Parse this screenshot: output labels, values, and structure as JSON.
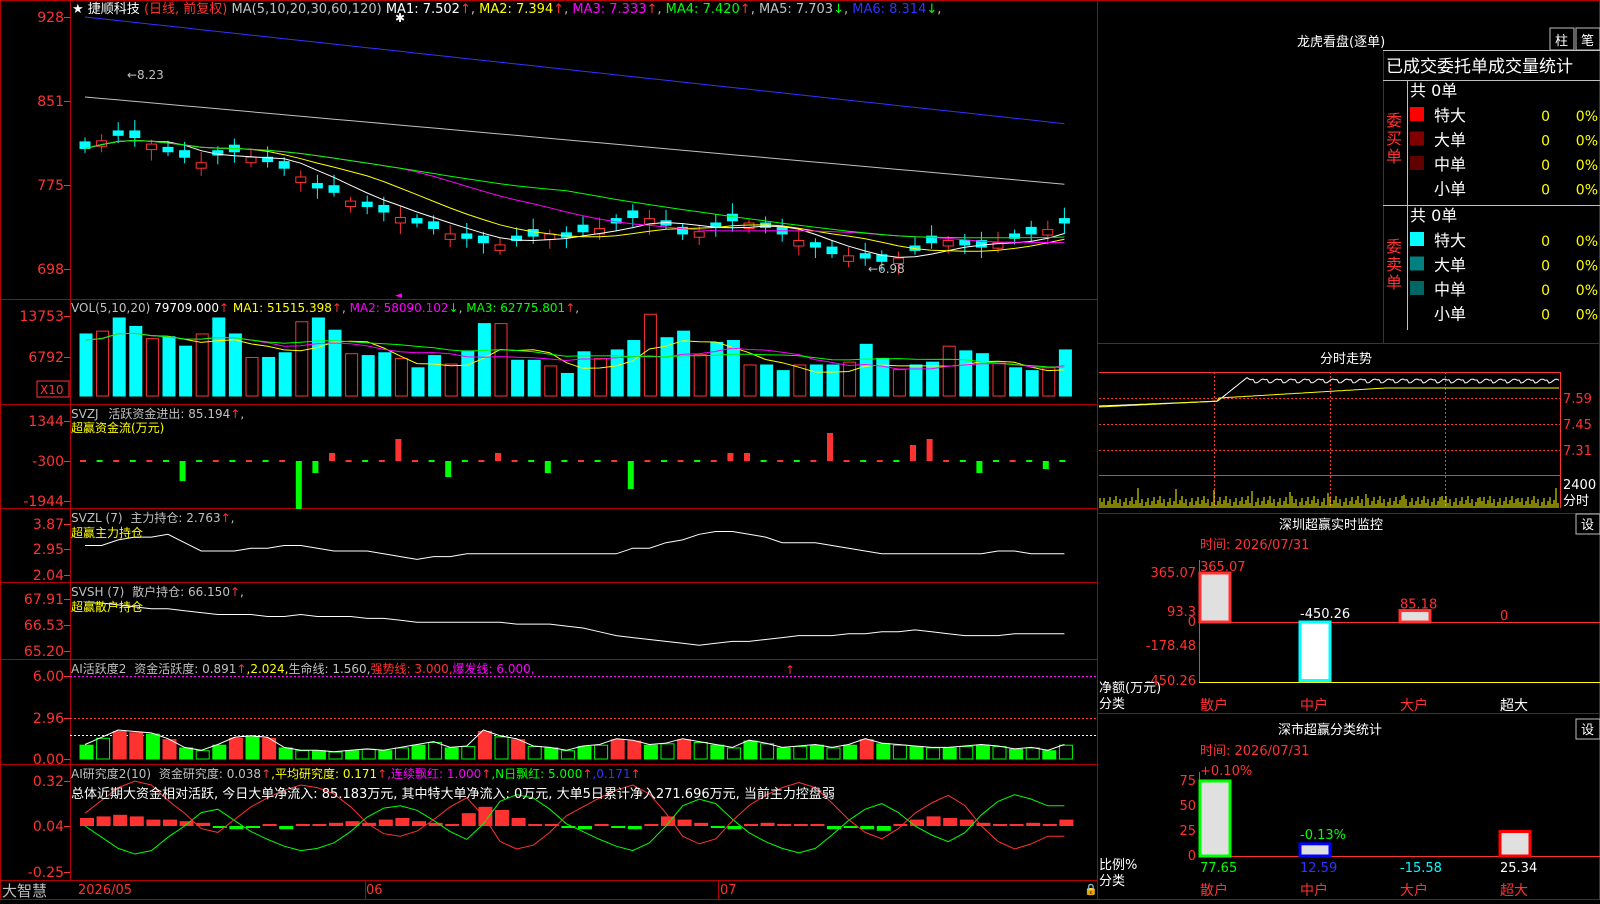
{
  "colors": {
    "up": "#ff3232",
    "down": "#00ffff",
    "grid": "#b40000",
    "yellow": "#ffff00",
    "magenta": "#ff00ff",
    "green": "#00ff00",
    "blue": "#3232ff",
    "white": "#ffffff",
    "gray": "#c0c0c0"
  },
  "header": {
    "star": "★",
    "stock": "捷顺科技",
    "period": "(日线, 前复权)",
    "ma_params": "MA(5,10,20,30,60,120)",
    "ma_items": [
      {
        "label": "MA1:",
        "value": "7.502",
        "arrow": "↑",
        "color": "#ffffff"
      },
      {
        "label": "MA2:",
        "value": "7.394",
        "arrow": "↑",
        "color": "#ffff00"
      },
      {
        "label": "MA3:",
        "value": "7.333",
        "arrow": "↑",
        "color": "#ff00ff"
      },
      {
        "label": "MA4:",
        "value": "7.420",
        "arrow": "↑",
        "color": "#00ff00"
      },
      {
        "label": "MA5:",
        "value": "7.703",
        "arrow": "↓",
        "color": "#c0c0c0"
      },
      {
        "label": "MA6:",
        "value": "8.314",
        "arrow": "↓",
        "color": "#3232ff"
      }
    ]
  },
  "price_axis": [
    "928",
    "851",
    "775",
    "698"
  ],
  "price_annotations": {
    "high": "←8.23",
    "low": "←6.98"
  },
  "vol": {
    "header": "VOL(5,10,20)",
    "value": "79709.000",
    "value_arrow": "↑",
    "items": [
      {
        "label": "MA1:",
        "value": "51515.398",
        "arrow": "↑",
        "color": "#ffff00"
      },
      {
        "label": "MA2:",
        "value": "58090.102",
        "arrow": "↓",
        "color": "#ff00ff"
      },
      {
        "label": "MA3:",
        "value": "62775.801",
        "arrow": "↑",
        "color": "#00ff00"
      }
    ],
    "axis": [
      "13753",
      "6792"
    ],
    "unit": "X10"
  },
  "svzj": {
    "title": "SVZJ",
    "line1": "活跃资金进出: 85.194",
    "line1_arrow": "↑",
    "line2": "超赢资金流(万元)",
    "axis": [
      "1344",
      "-300",
      "-1944"
    ]
  },
  "svzl": {
    "title": "SVZL (7)",
    "line1": "主力持仓: 2.763",
    "line1_arrow": "↑",
    "line2": "超赢主力持仓",
    "axis": [
      "3.87",
      "2.95",
      "2.04"
    ]
  },
  "svsh": {
    "title": "SVSH (7)",
    "line1": "散户持仓: 66.150",
    "line1_arrow": "↑",
    "line2": "超赢散户持仓",
    "axis": [
      "67.91",
      "66.53",
      "65.20"
    ]
  },
  "ai1": {
    "title": "AI活跃度2",
    "items": [
      {
        "text": "资金活跃度: 0.891",
        "color": "#c0c0c0"
      },
      {
        "text": "↑",
        "color": "#ff3232"
      },
      {
        "text": ",2.024,",
        "color": "#ffff00"
      },
      {
        "text": "生命线: 1.560,",
        "color": "#c0c0c0"
      },
      {
        "text": "强势线: 3.000,",
        "color": "#ff3232"
      },
      {
        "text": "爆发线: 6.000,",
        "color": "#ff00ff"
      }
    ],
    "axis": [
      "6.00",
      "2.96",
      "0.00"
    ]
  },
  "ai2": {
    "title": "AI研究度2(10)",
    "items": [
      {
        "text": "资金研究度: 0.038",
        "color": "#c0c0c0"
      },
      {
        "text": "↑",
        "color": "#ff3232"
      },
      {
        "text": ",平均研究度: 0.171",
        "color": "#ffff00"
      },
      {
        "text": "↑",
        "color": "#ff3232"
      },
      {
        "text": ",连续飘红: 1.000",
        "color": "#ff00ff"
      },
      {
        "text": "↑",
        "color": "#ff3232"
      },
      {
        "text": ",N日飘红: 5.000",
        "color": "#00ff00"
      },
      {
        "text": "↑",
        "color": "#ff3232"
      },
      {
        "text": ",0.171",
        "color": "#3232ff"
      },
      {
        "text": "↑",
        "color": "#ff3232"
      }
    ],
    "summary": "总体近期大资金相对活跃, 今日大单净流入: 85.183万元, 其中特大单净流入: 0万元, 大单5日累计净入271.696万元, 当前主力控盘弱",
    "axis": [
      "0.32",
      "0.04",
      "-0.25"
    ]
  },
  "bottom": {
    "brand": "大智慧",
    "dates": [
      "2026/05",
      "06",
      "07"
    ]
  },
  "lhb": {
    "title": "龙虎看盘(逐单)",
    "btn1": "柱",
    "btn2": "笔",
    "subtitle": "已成交委托单成交量统计",
    "buy": {
      "label": "委买单",
      "count": "共 0单",
      "rows": [
        {
          "name": "特大",
          "val": "0",
          "pct": "0%",
          "color": "#ff0000"
        },
        {
          "name": "大单",
          "val": "0",
          "pct": "0%",
          "color": "#800000"
        },
        {
          "name": "中单",
          "val": "0",
          "pct": "0%",
          "color": "#600000"
        },
        {
          "name": "小单",
          "val": "0",
          "pct": "0%",
          "color": "#000000"
        }
      ]
    },
    "sell": {
      "label": "委卖单",
      "count": "共 0单",
      "rows": [
        {
          "name": "特大",
          "val": "0",
          "pct": "0%",
          "color": "#00ffff"
        },
        {
          "name": "大单",
          "val": "0",
          "pct": "0%",
          "color": "#008080"
        },
        {
          "name": "中单",
          "val": "0",
          "pct": "0%",
          "color": "#006666"
        },
        {
          "name": "小单",
          "val": "0",
          "pct": "0%",
          "color": "#000000"
        }
      ]
    }
  },
  "intraday": {
    "title": "分时走势",
    "axis": [
      "7.59",
      "7.45",
      "7.31"
    ],
    "vol_axis": [
      "2400",
      "分时"
    ]
  },
  "szmon": {
    "title": "深圳超赢实时监控",
    "btn": "设",
    "time": "时间: 2026/07/31",
    "axis": [
      "365.07",
      "93.3",
      "0",
      "-178.48",
      "-450.26"
    ],
    "ylab1": "净额(万元)",
    "ylab2": "分类",
    "bars": [
      {
        "cat": "散户",
        "value": 365.07,
        "label": "365.07"
      },
      {
        "cat": "中户",
        "value": -450.26,
        "label": "-450.26"
      },
      {
        "cat": "大户",
        "value": 85.18,
        "label": "85.18"
      },
      {
        "cat": "超大",
        "value": 0,
        "label": "0"
      }
    ]
  },
  "szstat": {
    "title": "深市超赢分类统计",
    "btn": "设",
    "time": "时间: 2026/07/31",
    "top_label": "+0.10%",
    "axis": [
      "75",
      "50",
      "25",
      "0"
    ],
    "ylab1": "比例%",
    "ylab2": "分类",
    "bars": [
      {
        "cat": "散户",
        "value": 77.65,
        "label": "77.65",
        "color": "#00ff00"
      },
      {
        "cat": "中户",
        "value": 12.59,
        "label": "12.59",
        "color": "#0000ff"
      },
      {
        "cat": "大户",
        "value": -15.58,
        "label": "-15.58",
        "color": "#00ffff"
      },
      {
        "cat": "超大",
        "value": 25.34,
        "label": "25.34",
        "color": "#ff0000"
      }
    ],
    "mid_label": "-0.13%"
  }
}
